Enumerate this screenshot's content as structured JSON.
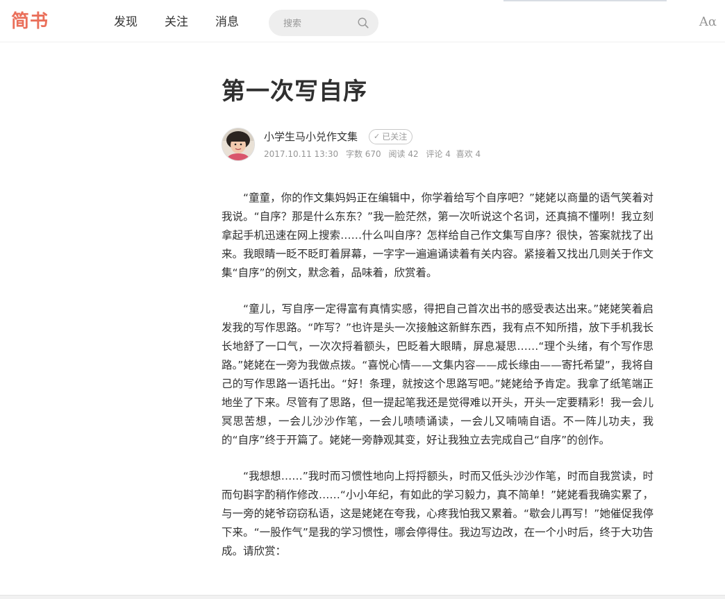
{
  "header": {
    "logo": "简书",
    "nav": [
      "发现",
      "关注",
      "消息"
    ],
    "search_placeholder": "搜索",
    "font_toggle": "Aα"
  },
  "article": {
    "title": "第一次写自序",
    "author": {
      "name": "小学生马小兑作文集",
      "follow_label": "已关注"
    },
    "meta": {
      "date": "2017.10.11 13:30",
      "words": "字数 670",
      "reads": "阅读 42",
      "comments": "评论 4",
      "likes": "喜欢 4"
    },
    "paragraphs": [
      "“童童，你的作文集妈妈正在编辑中，你学着给写个自序吧？”姥姥以商量的语气笑着对我说。“自序？那是什么东东？”我一脸茫然，第一次听说这个名词，还真搞不懂咧！我立刻拿起手机迅速在网上搜索……什么叫自序？怎样给自己作文集写自序？很快，答案就找了出来。我眼睛一眨不眨盯着屏幕，一字字一遍遍诵读着有关内容。紧接着又找出几则关于作文集“自序”的例文，默念着，品味着，欣赏着。",
      "“童儿，写自序一定得富有真情实感，得把自己首次出书的感受表达出来。”姥姥笑着启发我的写作思路。“咋写？”也许是头一次接触这新鲜东西，我有点不知所措，放下手机我长长地舒了一口气，一次次捋着额头，巴眨着大眼睛，屏息凝思……“理个头绪，有个写作思路。”姥姥在一旁为我做点拨。“喜悦心情——文集内容——成长缘由——寄托希望”，我将自己的写作思路一语托出。“好！条理，就按这个思路写吧。”姥姥给予肯定。我拿了纸笔端正地坐了下来。尽管有了思路，但一提起笔我还是觉得难以开头，开头一定要精彩！我一会儿冥思苦想，一会儿沙沙作笔，一会儿啧啧诵读，一会儿又喃喃自语。不一阵儿功夫，我的“自序”终于开篇了。姥姥一旁静观其变，好让我独立去完成自己“自序”的创作。",
      "“我想想……”我时而习惯性地向上捋捋额头，时而又低头沙沙作笔，时而自我赏读，时而句斟字酌稍作修改……“小小年纪，有如此的学习毅力，真不简单！”姥姥看我确实累了，与一旁的姥爷窃窃私语，这是姥姥在夸我，心疼我怕我又累着。“歇会儿再写！”她催促我停下来。“一股作气”是我的学习惯性，哪会停得住。我边写边改，在一个小时后，终于大功告成。请欣赏："
    ]
  }
}
